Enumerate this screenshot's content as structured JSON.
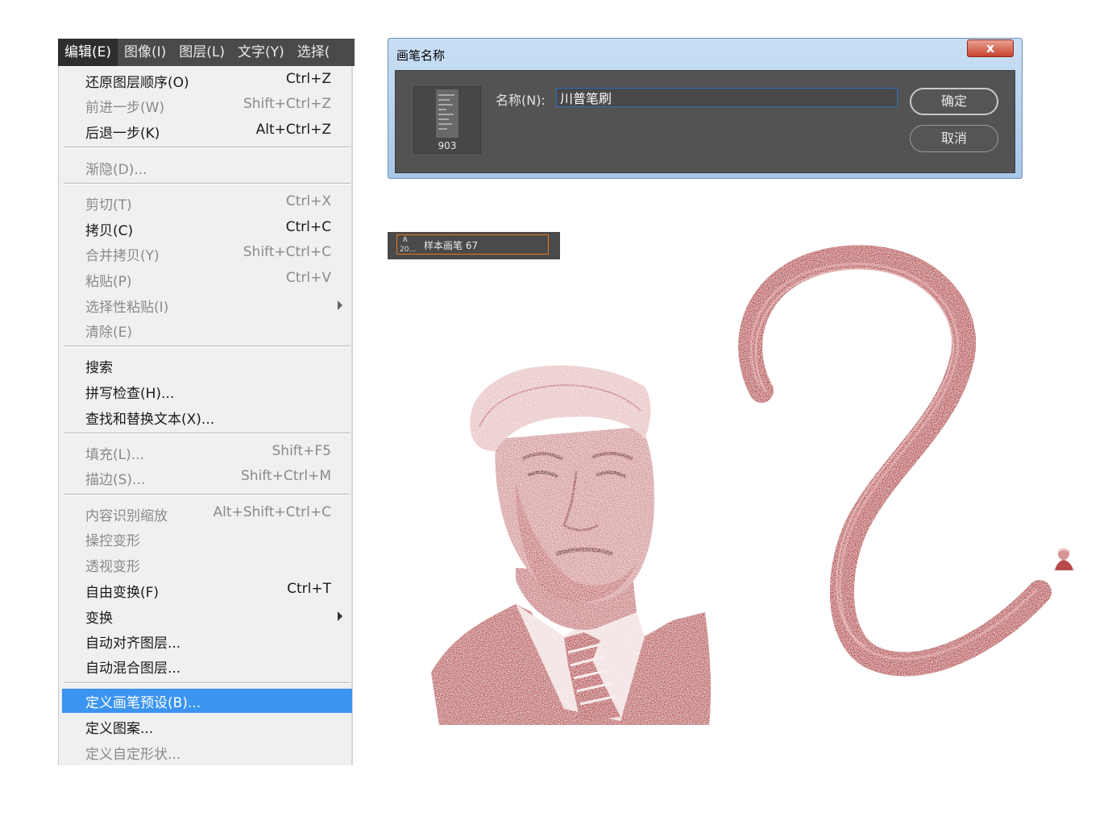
{
  "menubar": {
    "items": [
      "编辑(E)",
      "图像(I)",
      "图层(L)",
      "文字(Y)",
      "选择("
    ]
  },
  "menu": {
    "items": [
      {
        "label": "还原图层顺序(O)",
        "shortcut": "Ctrl+Z",
        "enabled": true
      },
      {
        "label": "前进一步(W)",
        "shortcut": "Shift+Ctrl+Z",
        "enabled": false
      },
      {
        "label": "后退一步(K)",
        "shortcut": "Alt+Ctrl+Z",
        "enabled": true
      },
      {
        "label": "渐隐(D)...",
        "shortcut": "",
        "enabled": false
      },
      {
        "label": "剪切(T)",
        "shortcut": "Ctrl+X",
        "enabled": false
      },
      {
        "label": "拷贝(C)",
        "shortcut": "Ctrl+C",
        "enabled": true
      },
      {
        "label": "合并拷贝(Y)",
        "shortcut": "Shift+Ctrl+C",
        "enabled": false
      },
      {
        "label": "粘贴(P)",
        "shortcut": "Ctrl+V",
        "enabled": false
      },
      {
        "label": "选择性粘贴(I)",
        "shortcut": "",
        "enabled": false,
        "submenu": true
      },
      {
        "label": "清除(E)",
        "shortcut": "",
        "enabled": false
      },
      {
        "label": "搜索",
        "shortcut": "",
        "enabled": true
      },
      {
        "label": "拼写检查(H)...",
        "shortcut": "",
        "enabled": true
      },
      {
        "label": "查找和替换文本(X)...",
        "shortcut": "",
        "enabled": true
      },
      {
        "label": "填充(L)...",
        "shortcut": "Shift+F5",
        "enabled": false
      },
      {
        "label": "描边(S)...",
        "shortcut": "Shift+Ctrl+M",
        "enabled": false
      },
      {
        "label": "内容识别缩放",
        "shortcut": "Alt+Shift+Ctrl+C",
        "enabled": false
      },
      {
        "label": "操控变形",
        "shortcut": "",
        "enabled": false
      },
      {
        "label": "透视变形",
        "shortcut": "",
        "enabled": false
      },
      {
        "label": "自由变换(F)",
        "shortcut": "Ctrl+T",
        "enabled": true
      },
      {
        "label": "变换",
        "shortcut": "",
        "enabled": true,
        "submenu": true
      },
      {
        "label": "自动对齐图层...",
        "shortcut": "",
        "enabled": true
      },
      {
        "label": "自动混合图层...",
        "shortcut": "",
        "enabled": true
      },
      {
        "label": "定义画笔预设(B)...",
        "shortcut": "",
        "enabled": true,
        "highlighted": true
      },
      {
        "label": "定义图案...",
        "shortcut": "",
        "enabled": true
      },
      {
        "label": "定义自定形状...",
        "shortcut": "",
        "enabled": false
      }
    ]
  },
  "dialog": {
    "title": "画笔名称",
    "close_label": "x",
    "thumb_size": "903",
    "name_label": "名称(N):",
    "name_value": "川普笔刷",
    "ok_label": "确定",
    "cancel_label": "取消"
  },
  "preset": {
    "size": "20...",
    "name": "样本画笔 67"
  },
  "colors": {
    "brush_red": "#b94a4c",
    "menu_highlight": "#3a94f0",
    "dialog_body": "#535353"
  }
}
